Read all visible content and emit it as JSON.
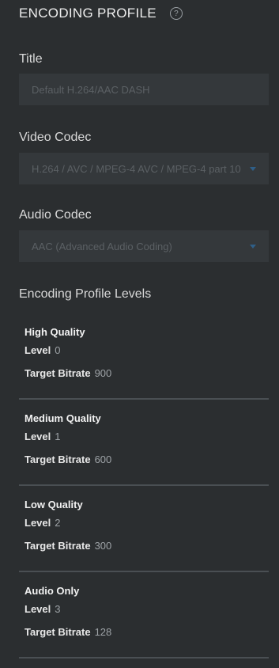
{
  "header": {
    "title": "ENCODING PROFILE",
    "help_glyph": "?"
  },
  "title_field": {
    "label": "Title",
    "value": "Default H.264/AAC DASH"
  },
  "video_codec": {
    "label": "Video Codec",
    "value": "H.264 / AVC / MPEG-4 AVC / MPEG-4 part 10"
  },
  "audio_codec": {
    "label": "Audio Codec",
    "value": "AAC (Advanced Audio Coding)"
  },
  "levels_section": {
    "title": "Encoding Profile Levels",
    "level_label": "Level",
    "bitrate_label": "Target Bitrate",
    "items": [
      {
        "name": "High Quality",
        "level": "0",
        "bitrate": "900"
      },
      {
        "name": "Medium Quality",
        "level": "1",
        "bitrate": "600"
      },
      {
        "name": "Low Quality",
        "level": "2",
        "bitrate": "300"
      },
      {
        "name": "Audio Only",
        "level": "3",
        "bitrate": "128"
      }
    ]
  },
  "colors": {
    "background": "#2b2e30",
    "field": "#34383b",
    "caret": "#2f5f88",
    "divider": "#4a4f53"
  },
  "icons": {
    "help": "help-circle-icon",
    "dropdown": "chevron-down-icon"
  }
}
